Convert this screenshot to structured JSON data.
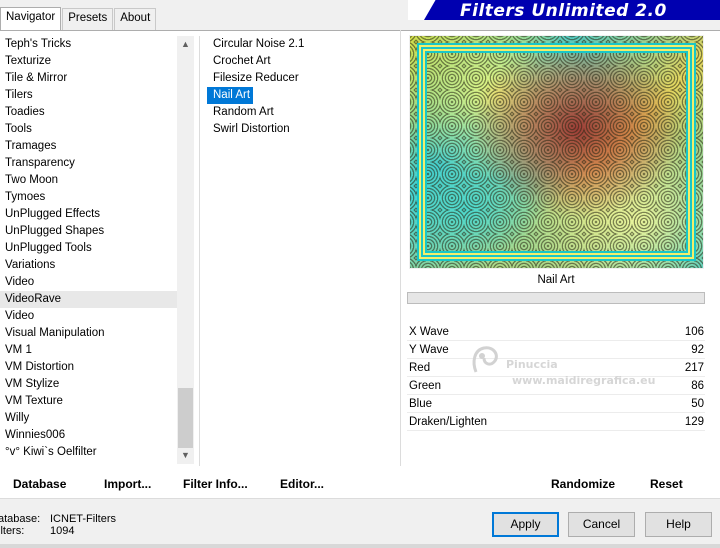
{
  "tabs": [
    "Navigator",
    "Presets",
    "About"
  ],
  "active_tab": "Navigator",
  "app_title": "Filters Unlimited 2.0",
  "categories": [
    "Teph's Tricks",
    "Texturize",
    "Tile & Mirror",
    "Tilers",
    "Toadies",
    "Tools",
    "Tramages",
    "Transparency",
    "Two Moon",
    "Tymoes",
    "UnPlugged Effects",
    "UnPlugged Shapes",
    "UnPlugged Tools",
    "Variations",
    "Video",
    "VideoRave",
    "Video",
    "Visual Manipulation",
    "VM 1",
    "VM Distortion",
    "VM Stylize",
    "VM Texture",
    "Willy",
    "Winnies006",
    "°v° Kiwi`s Oelfilter"
  ],
  "highlighted_category": "VideoRave",
  "filters": [
    "Circular Noise 2.1",
    "Crochet Art",
    "Filesize Reducer",
    "Nail Art",
    "Random Art",
    "Swirl Distortion"
  ],
  "selected_filter": "Nail Art",
  "preview_label": "Nail Art",
  "params": [
    {
      "label": "X Wave",
      "value": "106"
    },
    {
      "label": "Y Wave",
      "value": "92"
    },
    {
      "label": "Red",
      "value": "217"
    },
    {
      "label": "Green",
      "value": "86"
    },
    {
      "label": "Blue",
      "value": "50"
    },
    {
      "label": "Draken/Lighten",
      "value": "129"
    }
  ],
  "watermark": {
    "line1": "Pinuccia",
    "line2": "www.maidiregrafica.eu"
  },
  "bottom_links": {
    "database": "Database",
    "import": "Import...",
    "filter_info": "Filter Info...",
    "editor": "Editor...",
    "randomize": "Randomize",
    "reset": "Reset"
  },
  "status": {
    "database_label": "atabase:",
    "database_value": "ICNET-Filters",
    "filters_label": "ilters:",
    "filters_value": "1094"
  },
  "buttons": {
    "apply": "Apply",
    "cancel": "Cancel",
    "help": "Help"
  },
  "colors": {
    "selection": "#0078d7",
    "title_band": "#0000b0"
  }
}
